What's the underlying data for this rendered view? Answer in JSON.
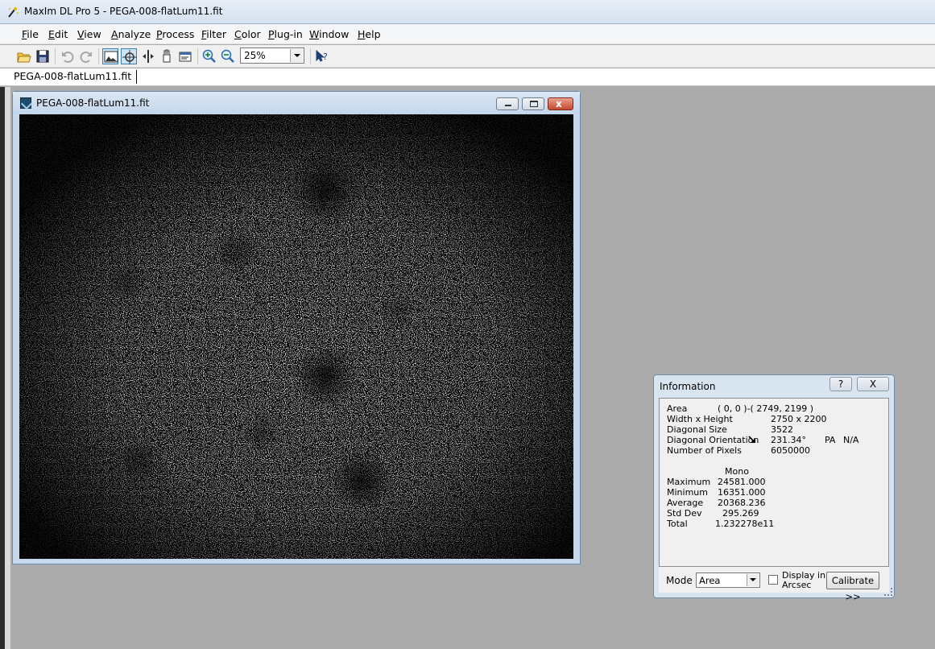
{
  "app": {
    "title": "MaxIm DL Pro 5 - PEGA-008-flatLum11.fit"
  },
  "menu": [
    "File",
    "Edit",
    "View",
    "Analyze",
    "Process",
    "Filter",
    "Color",
    "Plug-in",
    "Window",
    "Help"
  ],
  "toolbar": {
    "zoom_value": "25%",
    "icons": [
      "open-icon",
      "save-icon",
      "undo-icon",
      "redo-icon",
      "screen-stretch-icon",
      "crosshair-icon",
      "split-icon",
      "hand-icon",
      "info-icon",
      "zoom-in-icon",
      "zoom-out-icon",
      "context-help-icon"
    ]
  },
  "tabs": {
    "active": "PEGA-008-flatLum11.fit"
  },
  "image_window": {
    "title": "PEGA-008-flatLum11.fit",
    "close_glyph": "x"
  },
  "info_window": {
    "title": "Information",
    "help_label": "?",
    "close_label": "X",
    "rows": {
      "area_label": "Area",
      "area_value": "( 0, 0 )-( 2749, 2199 )",
      "wh_label": "Width x Height",
      "wh_value": "2750 x 2200",
      "diag_size_label": "Diagonal Size",
      "diag_size_value": "3522",
      "diag_orient_label": "Diagonal Orientation",
      "diag_orient_value": "231.34°",
      "pa_label": "PA",
      "pa_value": "N/A",
      "pixels_label": "Number of Pixels",
      "pixels_value": "6050000"
    },
    "stats": {
      "column_header": "Mono",
      "maximum_label": "Maximum",
      "maximum_value": "24581.000",
      "minimum_label": "Minimum",
      "minimum_value": "16351.000",
      "average_label": "Average",
      "average_value": "20368.236",
      "stddev_label": "Std Dev",
      "stddev_value": "295.269",
      "total_label": "Total",
      "total_value": "1.232278e11"
    },
    "mode_label": "Mode",
    "mode_value": "Area",
    "arcsec_label": "Display in Arcsec",
    "arcsec_checked": false,
    "calibrate_label": "Calibrate >>"
  },
  "colors": {
    "desktop": "#ababab",
    "image_bg": "#000000",
    "titlebar": "#c3d6ea"
  }
}
